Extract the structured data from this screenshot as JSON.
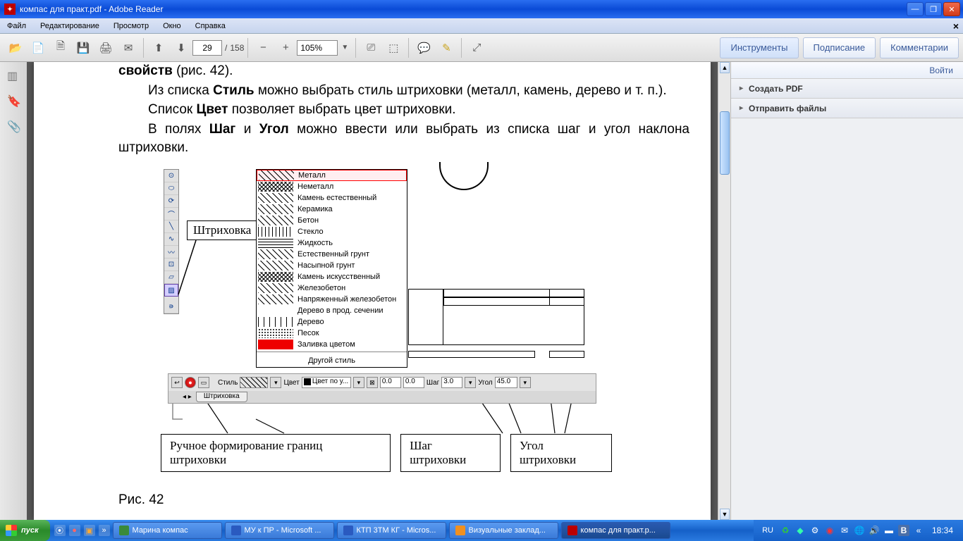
{
  "window": {
    "title": "компас для практ.pdf - Adobe Reader"
  },
  "menu": {
    "file": "Файл",
    "edit": "Редактирование",
    "view": "Просмотр",
    "window": "Окно",
    "help": "Справка"
  },
  "toolbar": {
    "page_current": "29",
    "page_sep": "/",
    "page_total": "158",
    "zoom": "105%",
    "tools": "Инструменты",
    "sign": "Подписание",
    "comment": "Комментарии"
  },
  "right_panel": {
    "login": "Войти",
    "create_pdf": "Создать PDF",
    "send_files": "Отправить файлы"
  },
  "document": {
    "line1a": "свойств",
    "line1b": " (рис. 42).",
    "line2a": "Из списка ",
    "line2b": "Стиль",
    "line2c": " можно выбрать стиль штриховки (металл, камень, дерево и т. п.).",
    "line3a": "Список ",
    "line3b": "Цвет",
    "line3c": " позволяет выбрать цвет штриховки.",
    "line4a": "В полях ",
    "line4b": "Шаг",
    "line4c": " и ",
    "line4d": "Угол",
    "line4e": " можно ввести или выбрать из списка шаг и угол наклона штриховки.",
    "fig_caption": "Рис. 42"
  },
  "figure": {
    "callout_hatch": "Штриховка",
    "dropdown": {
      "items": [
        "Металл",
        "Неметалл",
        "Камень естественный",
        "Керамика",
        "Бетон",
        "Стекло",
        "Жидкость",
        "Естественный грунт",
        "Насыпной грунт",
        "Камень искусственный",
        "Железобетон",
        "Напряженный железобетон",
        "Дерево в прод. сечении",
        "Дерево",
        "Песок",
        "Заливка цветом"
      ],
      "other": "Другой стиль"
    },
    "prop": {
      "style_lbl": "Стиль",
      "color_lbl": "Цвет",
      "color_val": "Цвет по у...",
      "v1": "0.0",
      "v2": "0.0",
      "step_lbl": "Шаг",
      "step_val": "3.0",
      "angle_lbl": "Угол",
      "angle_val": "45.0"
    },
    "tab_label": "Штриховка",
    "annot": {
      "manual": "Ручное формирование границ штриховки",
      "step": "Шаг штриховки",
      "angle": "Угол штриховки"
    }
  },
  "taskbar": {
    "start": "пуск",
    "items": [
      {
        "label": "Марина компас",
        "icon_color": "#3a8a3a"
      },
      {
        "label": "МУ к ПР - Microsoft ...",
        "icon_color": "#2a5ac0"
      },
      {
        "label": "КТП 3ТМ КГ - Micros...",
        "icon_color": "#2a5ac0"
      },
      {
        "label": "Визуальные заклад...",
        "icon_color": "#f09020"
      },
      {
        "label": "компас для практ.p...",
        "icon_color": "#b00"
      }
    ],
    "lang": "RU",
    "clock": "18:34"
  }
}
